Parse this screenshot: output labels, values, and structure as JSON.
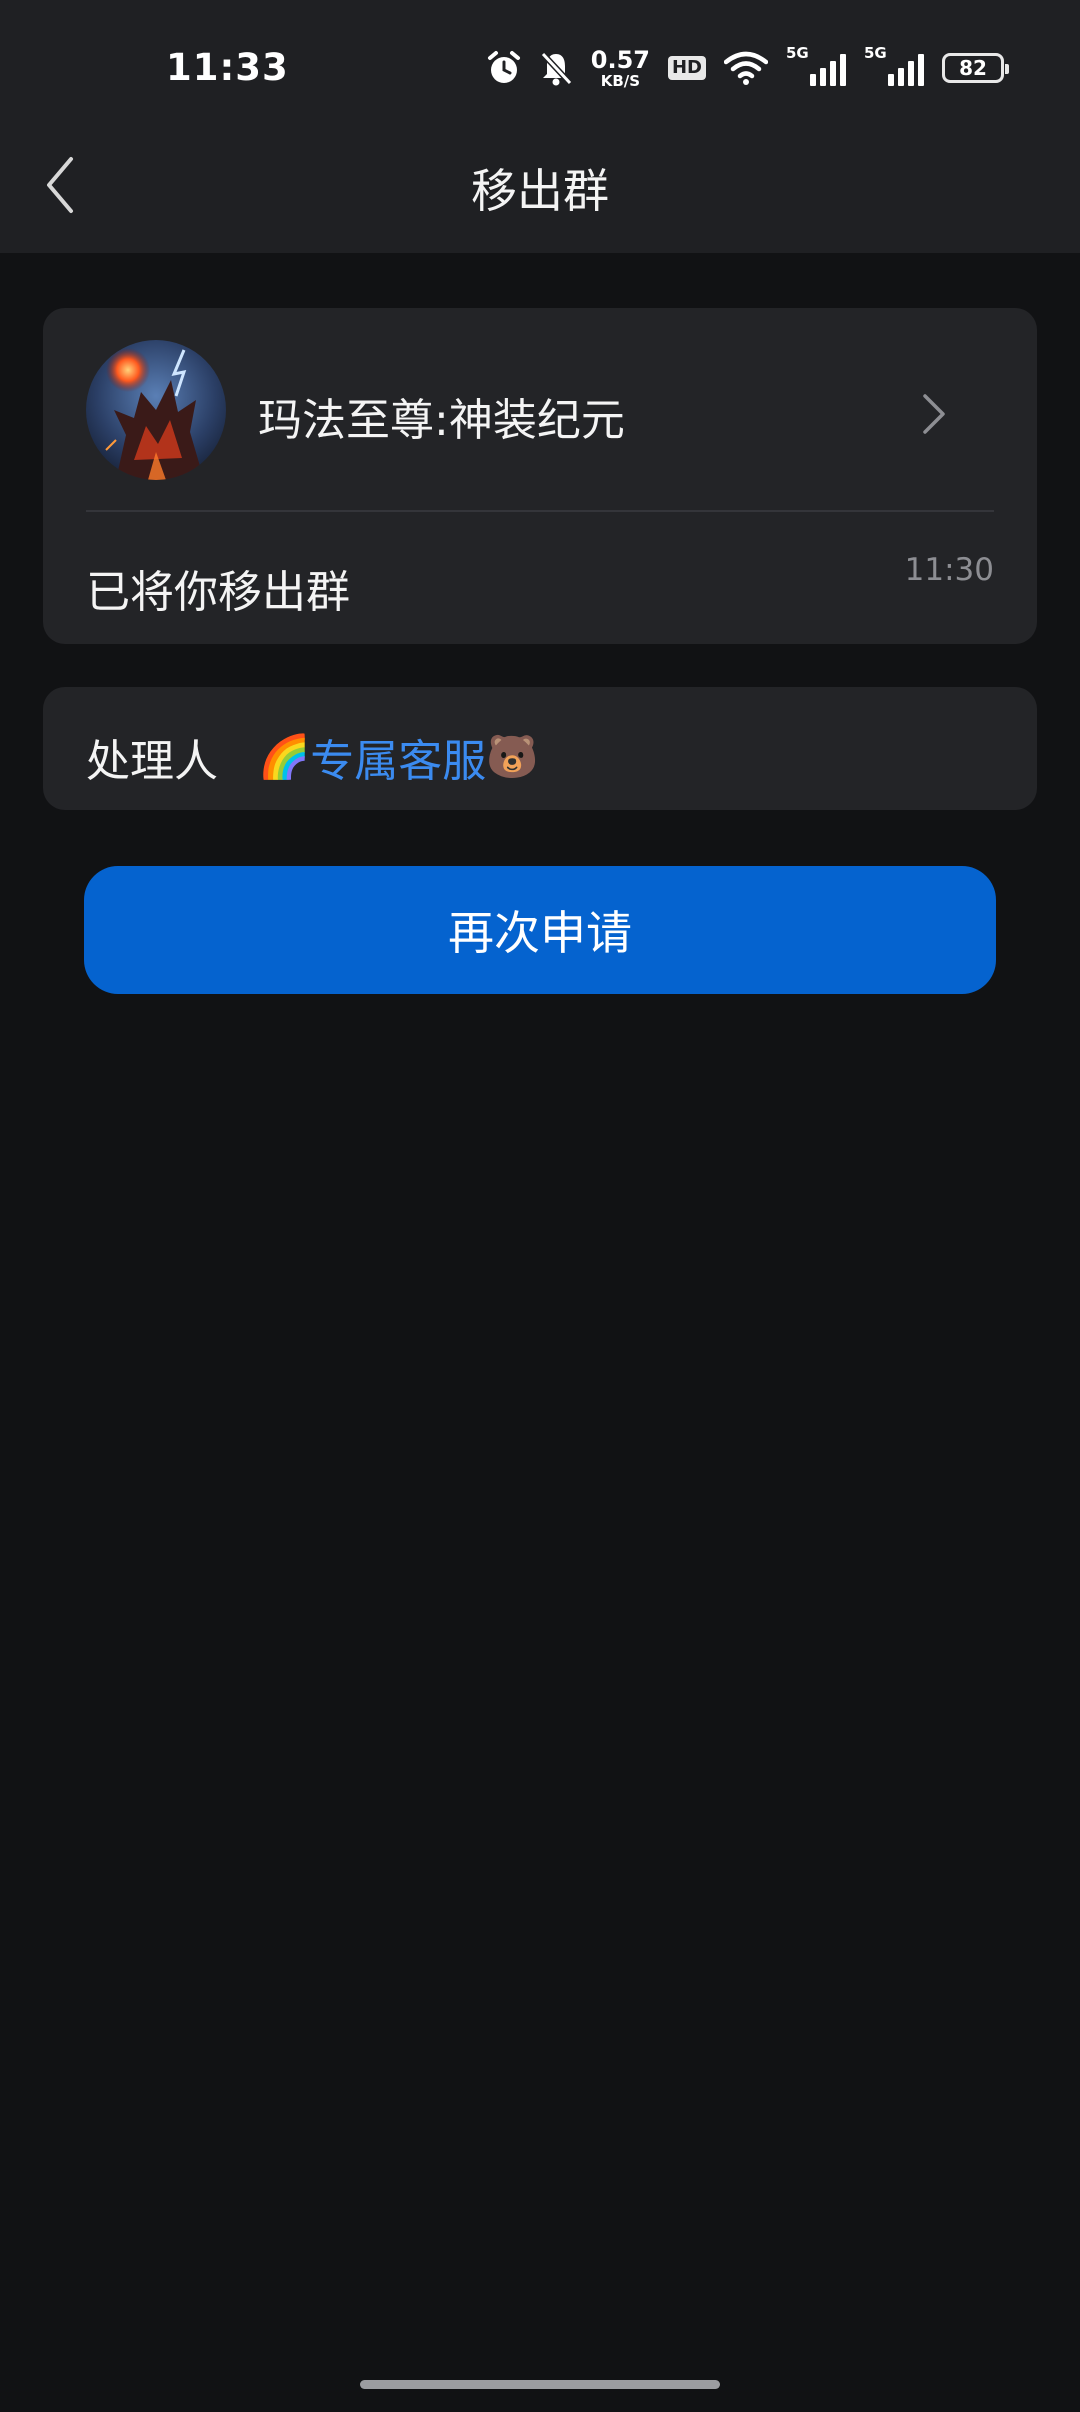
{
  "status_bar": {
    "time": "11:33",
    "net_speed_value": "0.57",
    "net_speed_unit": "KB/S",
    "hd_label": "HD",
    "sim1_label": "5G",
    "sim2_label": "5G",
    "battery_level": "82"
  },
  "header": {
    "title": "移出群"
  },
  "group": {
    "name": "玛法至尊:神装纪元",
    "notice": "已将你移出群",
    "time": "11:30"
  },
  "handler": {
    "label": "处理人",
    "name": "专属客服",
    "prefix_emoji": "🌈",
    "suffix_emoji": "🐻"
  },
  "actions": {
    "reapply_label": "再次申请"
  },
  "colors": {
    "background": "#111214",
    "header": "#1f2023",
    "card": "#232427",
    "accent": "#0563cf",
    "link": "#3b8bf0"
  }
}
